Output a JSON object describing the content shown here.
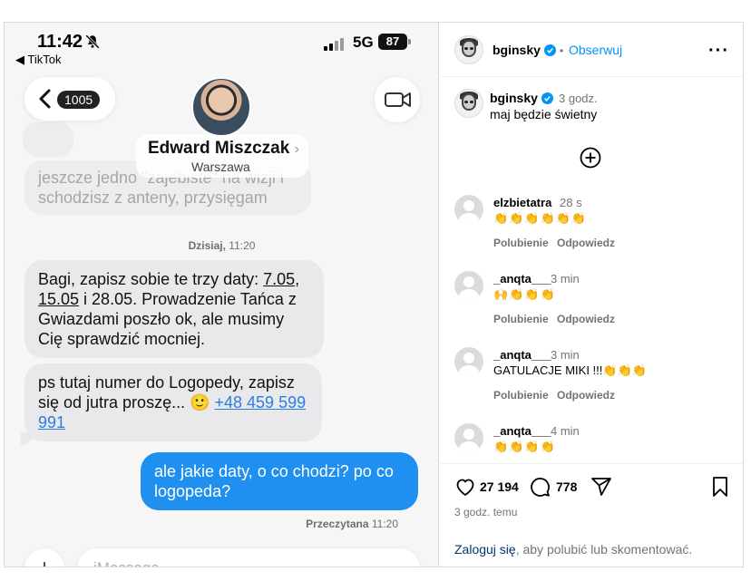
{
  "phone": {
    "status_time": "11:42",
    "back_app": "◀ TikTok",
    "network": "5G",
    "battery": "87",
    "back_count": "1005",
    "contact_name": "Edward Miszczak",
    "contact_chevron": "›",
    "contact_city": "Warszawa",
    "messages": {
      "faded_text": "jeszcze jedno \"zajebiste\" na wizji i schodzisz z anteny, przysięgam",
      "timestamp_day": "Dzisiaj,",
      "timestamp_time": "11:20",
      "msg1_a": "Bagi, zapisz sobie te trzy daty: ",
      "msg1_d1": "7.05",
      "msg1_sep1": ", ",
      "msg1_d2": "15.05",
      "msg1_b": " i 28.05. Prowadzenie Tańca z Gwiazdami poszło ok, ale musimy Cię sprawdzić mocniej.",
      "msg2_a": "ps tutaj numer do Logopedy, zapisz się od jutra proszę... 🙂 ",
      "msg2_phone": "+48 459 599 991",
      "msg3": "ale jakie daty, o co chodzi? po co logopeda?",
      "read_label": "Przeczytana",
      "read_time": "11:20"
    },
    "input_placeholder": "iMessage",
    "plus_label": "+"
  },
  "instagram": {
    "username": "bginsky",
    "dot": "•",
    "follow_label": "Obserwuj",
    "more_label": "···",
    "post_time": "3 godz.",
    "caption": "maj będzie świetny",
    "comments": [
      {
        "user": "elzbietatra",
        "time": "28 s",
        "text": "👏👏👏👏👏👏",
        "like": "Polubienie",
        "reply": "Odpowiedz"
      },
      {
        "user": "_anqta___",
        "time": "3 min",
        "text": "🙌👏👏👏",
        "like": "Polubienie",
        "reply": "Odpowiedz"
      },
      {
        "user": "_anqta___",
        "time": "3 min",
        "text": "GATULACJE MIKI !!!👏👏👏",
        "like": "Polubienie",
        "reply": "Odpowiedz"
      },
      {
        "user": "_anqta___",
        "time": "4 min",
        "text": "👏👏👏👏"
      }
    ],
    "likes": "27 194",
    "comments_count": "778",
    "posted_ago": "3 godz. temu",
    "login_link": "Zaloguj się",
    "login_rest": ", aby polubić lub skomentować."
  },
  "colors": {
    "imessage_blue": "#1f8ff0",
    "ig_link": "#0095f6",
    "verified": "#0095f6"
  }
}
